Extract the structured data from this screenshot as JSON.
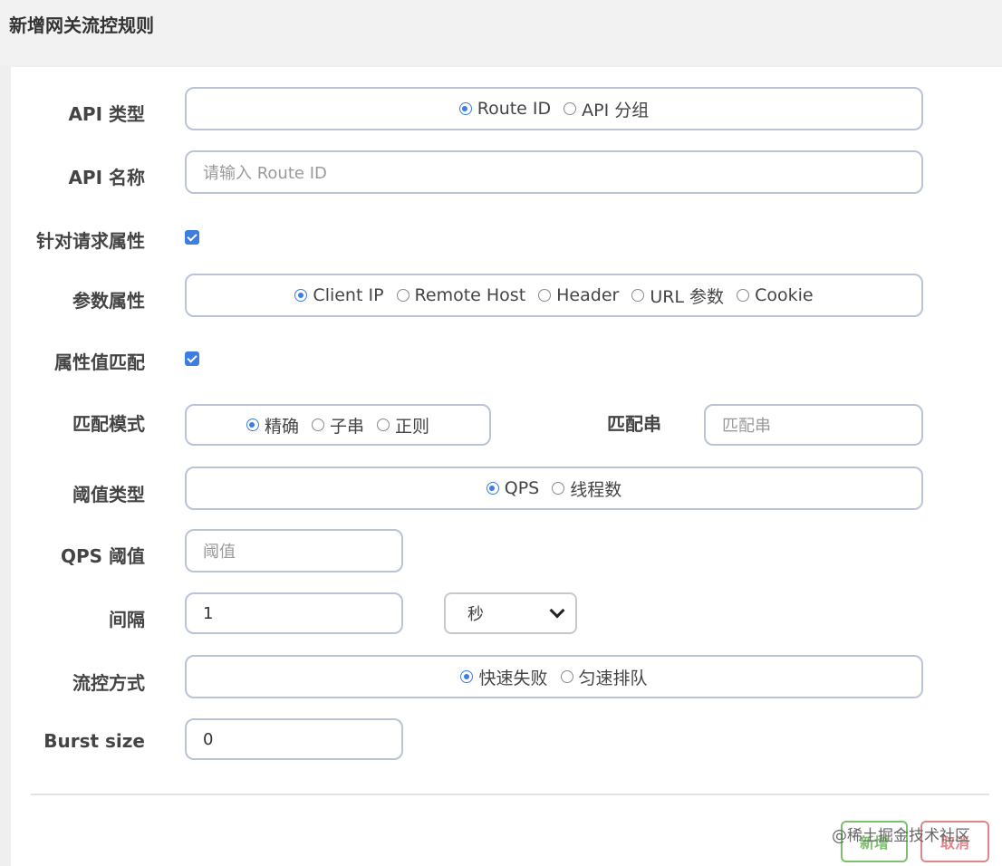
{
  "dialog": {
    "title": "新增网关流控规则"
  },
  "form": {
    "api_type": {
      "label": "API 类型",
      "options": [
        "Route ID",
        "API 分组"
      ],
      "selected": "Route ID"
    },
    "api_name": {
      "label": "API 名称",
      "placeholder": "请输入 Route ID"
    },
    "request_attr": {
      "label": "针对请求属性",
      "checked": true
    },
    "param_attr": {
      "label": "参数属性",
      "options": [
        "Client IP",
        "Remote Host",
        "Header",
        "URL 参数",
        "Cookie"
      ],
      "selected": "Client IP"
    },
    "attr_match": {
      "label": "属性值匹配",
      "checked": true
    },
    "match_mode": {
      "label": "匹配模式",
      "options": [
        "精确",
        "子串",
        "正则"
      ],
      "selected": "精确"
    },
    "match_string": {
      "label": "匹配串",
      "placeholder": "匹配串"
    },
    "threshold_type": {
      "label": "阈值类型",
      "options": [
        "QPS",
        "线程数"
      ],
      "selected": "QPS"
    },
    "qps_threshold": {
      "label": "QPS 阈值",
      "placeholder": "阈值"
    },
    "interval": {
      "label": "间隔",
      "value": "1",
      "unit": "秒"
    },
    "control_mode": {
      "label": "流控方式",
      "options": [
        "快速失败",
        "匀速排队"
      ],
      "selected": "快速失败"
    },
    "burst_size": {
      "label": "Burst size",
      "value": "0"
    }
  },
  "footer": {
    "add_label": "新增",
    "cancel_label": "取消",
    "watermark": "@稀土掘金技术社区"
  },
  "colors": {
    "accent": "#3b7de2",
    "border": "#b9c4d6",
    "add": "#7dbf6e",
    "cancel": "#e0868a"
  }
}
